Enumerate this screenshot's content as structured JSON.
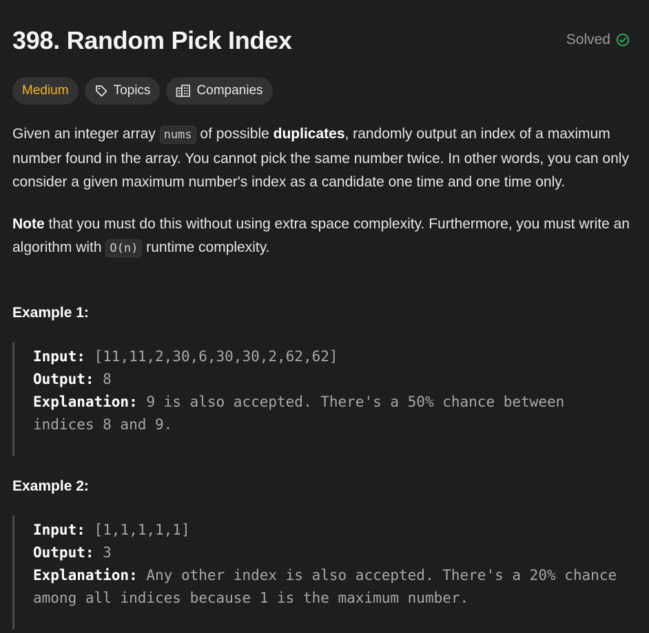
{
  "problem": {
    "title": "398. Random Pick Index",
    "status": "Solved"
  },
  "tags": {
    "difficulty": "Medium",
    "topics": "Topics",
    "companies": "Companies"
  },
  "description": {
    "p1": [
      "Given an integer array ",
      "nums",
      " of possible ",
      "duplicates",
      ", randomly output an index of a maximum number found in the array. You cannot pick the same number twice. In other words, you can only consider a given maximum number's index as a candidate one time and one time only."
    ],
    "p2": [
      "Note",
      " that you must do this without using extra space complexity. Furthermore, you must write an algorithm with ",
      "O(n)",
      " runtime complexity."
    ]
  },
  "examples": [
    {
      "heading": "Example 1:",
      "input_label": "Input:",
      "input_value": "[11,11,2,30,6,30,30,2,62,62]",
      "output_label": "Output:",
      "output_value": "8",
      "explanation_label": "Explanation:",
      "explanation_value": "9 is also accepted. There's a 50% chance between indices 8 and 9."
    },
    {
      "heading": "Example 2:",
      "input_label": "Input:",
      "input_value": "[1,1,1,1,1]",
      "output_label": "Output:",
      "output_value": "3",
      "explanation_label": "Explanation:",
      "explanation_value": "Any other index is also accepted. There's a 20% chance among all indices because 1 is the maximum number."
    }
  ],
  "colors": {
    "background": "#1e1e1e",
    "difficulty_medium": "#f2b52c",
    "solved_check": "#2cbb5d"
  },
  "icons": {
    "solved": "check-circle-icon",
    "topics": "tag-icon",
    "companies": "building-icon"
  }
}
